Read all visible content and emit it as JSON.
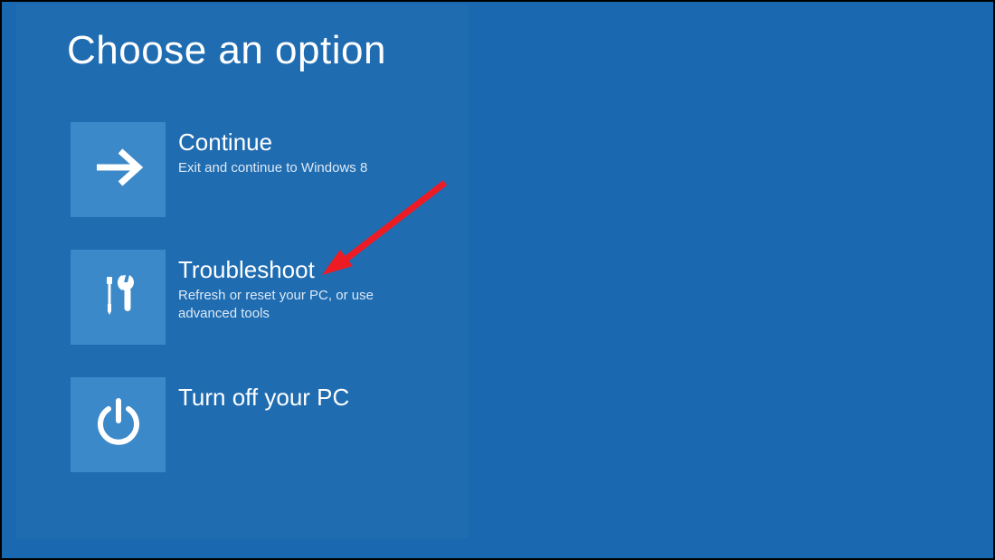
{
  "page_title": "Choose an option",
  "options": [
    {
      "icon": "arrow-right-icon",
      "title": "Continue",
      "desc": "Exit and continue to Windows 8"
    },
    {
      "icon": "tools-icon",
      "title": "Troubleshoot",
      "desc": "Refresh or reset your PC, or use advanced tools"
    },
    {
      "icon": "power-icon",
      "title": "Turn off your PC",
      "desc": ""
    }
  ],
  "colors": {
    "background": "#1a69b0",
    "tile": "#3b89c9",
    "annotation_arrow": "#ed1c24"
  }
}
